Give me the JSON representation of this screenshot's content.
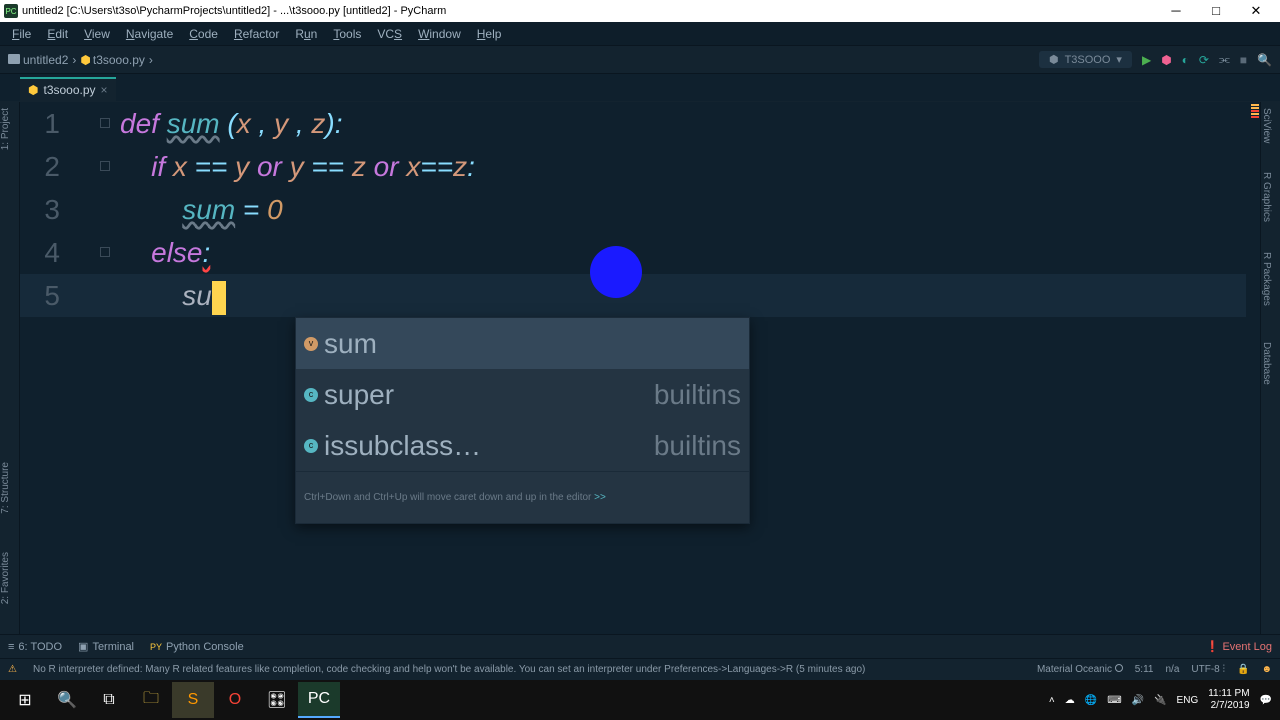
{
  "window": {
    "title": "untitled2 [C:\\Users\\t3so\\PycharmProjects\\untitled2] - ...\\t3sooo.py [untitled2] - PyCharm"
  },
  "menu": [
    "File",
    "Edit",
    "View",
    "Navigate",
    "Code",
    "Refactor",
    "Run",
    "Tools",
    "VCS",
    "Window",
    "Help"
  ],
  "breadcrumb": {
    "project": "untitled2",
    "file": "t3sooo.py"
  },
  "runconfig": {
    "name": "T3SOOO"
  },
  "tabs": {
    "active": "t3sooo.py"
  },
  "tool_windows_left": [
    "1: Project",
    "7: Structure",
    "2: Favorites"
  ],
  "tool_windows_right": [
    "SciView",
    "R Graphics",
    "R Packages",
    "Database"
  ],
  "code": {
    "lines": [
      {
        "n": "1",
        "frag": [
          {
            "t": "def ",
            "c": "kw"
          },
          {
            "t": "sum",
            "c": "name weak"
          },
          {
            "t": " (",
            "c": "punc"
          },
          {
            "t": "x",
            "c": "param"
          },
          {
            "t": " , ",
            "c": "punc"
          },
          {
            "t": "y",
            "c": "param"
          },
          {
            "t": " , ",
            "c": "punc"
          },
          {
            "t": "z",
            "c": "param"
          },
          {
            "t": "):",
            "c": "punc"
          }
        ],
        "indent": 0
      },
      {
        "n": "2",
        "frag": [
          {
            "t": "if ",
            "c": "kw"
          },
          {
            "t": "x",
            "c": "param"
          },
          {
            "t": " == ",
            "c": "op"
          },
          {
            "t": "y",
            "c": "param"
          },
          {
            "t": " or ",
            "c": "kw"
          },
          {
            "t": "y",
            "c": "param"
          },
          {
            "t": " == ",
            "c": "op"
          },
          {
            "t": "z",
            "c": "param"
          },
          {
            "t": " or ",
            "c": "kw"
          },
          {
            "t": "x",
            "c": "param"
          },
          {
            "t": "==",
            "c": "op"
          },
          {
            "t": "z",
            "c": "param"
          },
          {
            "t": ":",
            "c": "punc"
          }
        ],
        "indent": 1
      },
      {
        "n": "3",
        "frag": [
          {
            "t": "sum",
            "c": "name weak"
          },
          {
            "t": " = ",
            "c": "op"
          },
          {
            "t": "0",
            "c": "num"
          }
        ],
        "indent": 2
      },
      {
        "n": "4",
        "frag": [
          {
            "t": "else",
            "c": "kw"
          },
          {
            "t": ":",
            "c": "punc redsq"
          }
        ],
        "indent": 1
      },
      {
        "n": "5",
        "frag": [
          {
            "t": "su",
            "c": "typed"
          }
        ],
        "indent": 2,
        "cursor": true,
        "active": true
      }
    ]
  },
  "autocomplete": {
    "items": [
      {
        "label": "sum",
        "kind": "v",
        "extra": "",
        "selected": true
      },
      {
        "label": "super",
        "kind": "c",
        "extra": "builtins"
      },
      {
        "label": "issubclass…",
        "kind": "c",
        "extra": "builtins"
      }
    ],
    "hint_pre": "Ctrl+Down and Ctrl+Up will move caret down and up in the editor ",
    "hint_link": ">>"
  },
  "bottom_tools": [
    {
      "icon": "≡",
      "label": "6: TODO"
    },
    {
      "icon": "▣",
      "label": "Terminal"
    },
    {
      "icon": "PY",
      "label": "Python Console"
    }
  ],
  "event_log": "Event Log",
  "status": {
    "warn_icon": "⚠",
    "message": "No R interpreter defined: Many R related features like completion, code checking and help won't be available. You can set an interpreter under Preferences->Languages->R (5 minutes ago)",
    "theme": "Material Oceanic",
    "pos": "5:11",
    "na": "n/a",
    "enc": "UTF-8"
  },
  "taskbar": {
    "lang": "ENG",
    "time": "11:11 PM",
    "date": "2/7/2019"
  }
}
